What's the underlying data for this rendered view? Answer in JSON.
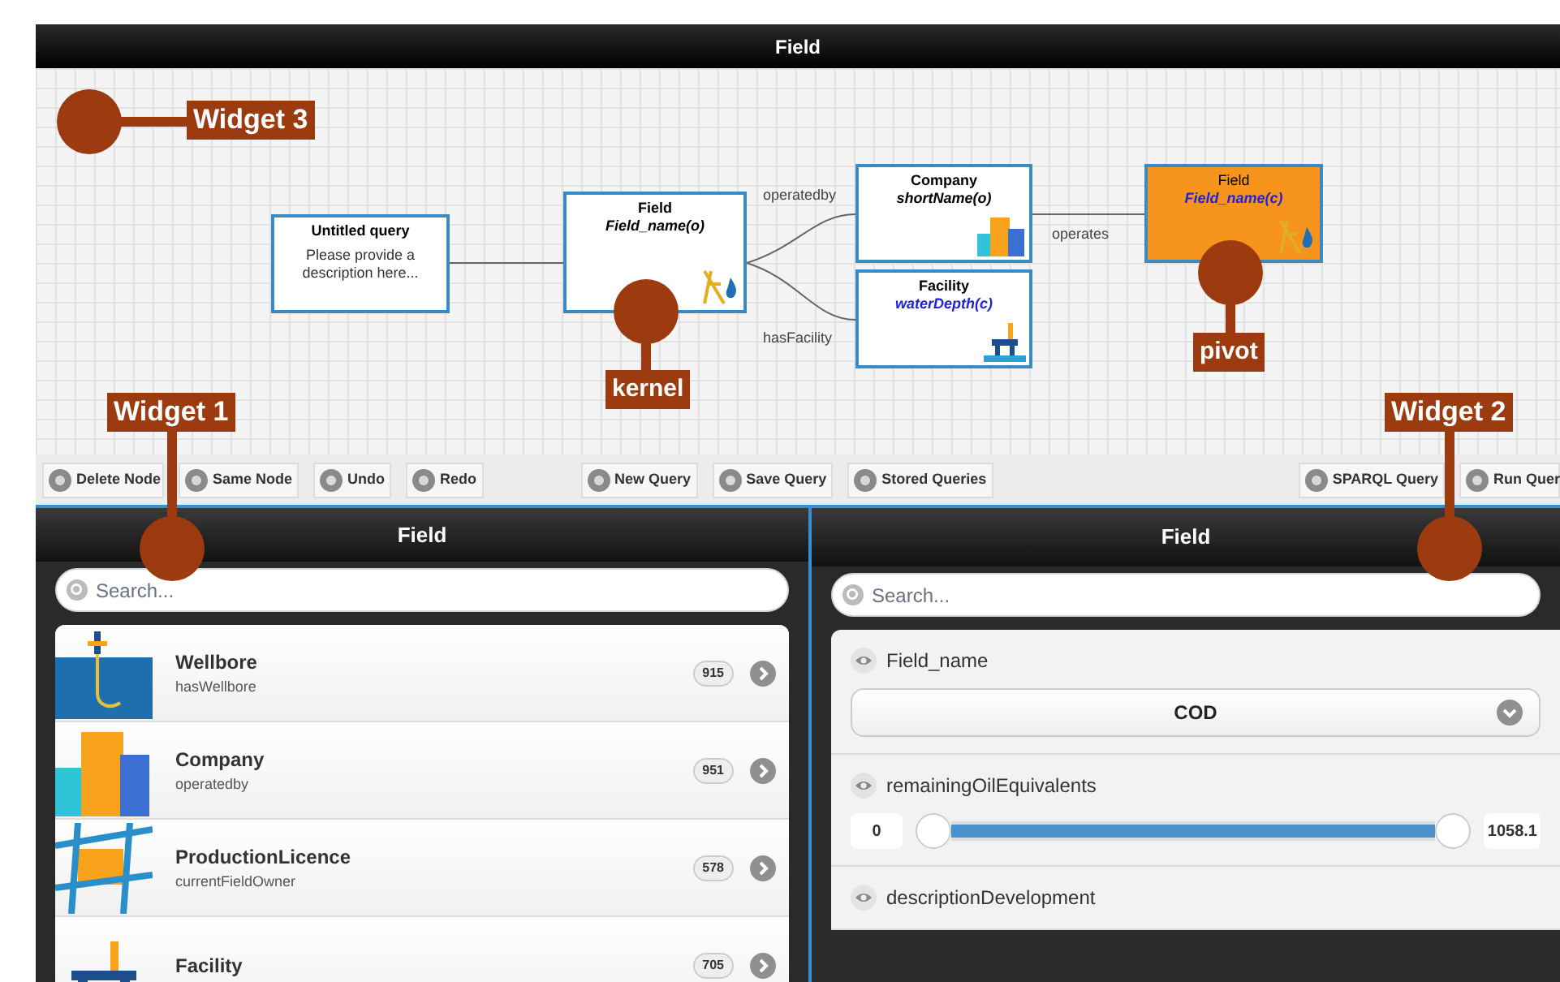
{
  "window": {
    "title": "Field"
  },
  "canvas": {
    "nodes": [
      {
        "kind": "query",
        "title": "Untitled query",
        "subtitle": "Please provide a description here...",
        "selected": false
      },
      {
        "kind": "field",
        "title": "Field",
        "subtitle": "Field_name(o)",
        "highlighted": false,
        "selected": false
      },
      {
        "kind": "company",
        "title": "Company",
        "subtitle": "shortName(o)",
        "highlighted": false,
        "selected": false
      },
      {
        "kind": "facility",
        "title": "Facility",
        "subtitle": "waterDepth(c)",
        "highlighted": true,
        "selected": false
      },
      {
        "kind": "field",
        "title": "Field",
        "subtitle": "Field_name(c)",
        "highlighted": true,
        "selected": true
      }
    ],
    "edge_labels": [
      "operatedby",
      "hasFacility",
      "operates"
    ]
  },
  "callouts": [
    {
      "kind": "left",
      "label": "Widget 3"
    },
    {
      "kind": "below",
      "label": "Widget 1"
    },
    {
      "kind": "below",
      "label": "Widget 2"
    },
    {
      "kind": "above",
      "label": "kernel"
    },
    {
      "kind": "above",
      "label": "pivot"
    }
  ],
  "toolbar": {
    "groups": [
      [
        "Delete Node",
        "Same Node",
        "Undo",
        "Redo"
      ],
      [
        "New Query",
        "Save Query",
        "Stored Queries"
      ],
      [
        "SPARQL Query",
        "Run Quer"
      ]
    ]
  },
  "left_panel": {
    "title": "Field",
    "search": {
      "placeholder": "Search..."
    },
    "items": [
      {
        "kind": "wellbore",
        "title": "Wellbore",
        "subtitle": "hasWellbore",
        "count": "915"
      },
      {
        "kind": "company",
        "title": "Company",
        "subtitle": "operatedby",
        "count": "951"
      },
      {
        "kind": "licence",
        "title": "ProductionLicence",
        "subtitle": "currentFieldOwner",
        "count": "578"
      },
      {
        "kind": "facility",
        "title": "Facility",
        "count": "705"
      }
    ]
  },
  "right_panel": {
    "title": "Field",
    "search": {
      "placeholder": "Search..."
    },
    "properties": [
      {
        "kind": "select",
        "name": "Field_name",
        "value": "COD"
      },
      {
        "kind": "range",
        "name": "remainingOilEquivalents",
        "min": "0",
        "max": "1058.1",
        "level": 1
      },
      {
        "kind": "text",
        "name": "descriptionDevelopment"
      }
    ]
  }
}
